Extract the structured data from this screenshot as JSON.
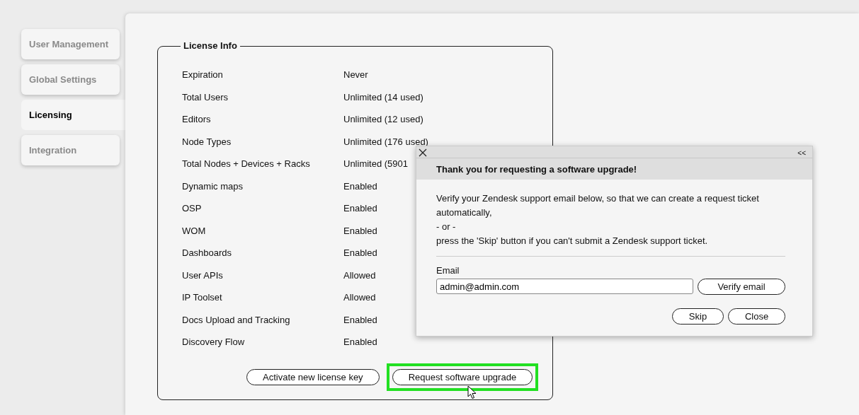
{
  "sidebar": {
    "tabs": [
      {
        "label": "User Management",
        "selected": false
      },
      {
        "label": "Global Settings",
        "selected": false
      },
      {
        "label": "Licensing",
        "selected": true
      },
      {
        "label": "Integration",
        "selected": false
      }
    ]
  },
  "license_info": {
    "title": "License Info",
    "rows": [
      {
        "label": "Expiration",
        "value": "Never"
      },
      {
        "label": "Total Users",
        "value": "Unlimited (14 used)"
      },
      {
        "label": "Editors",
        "value": "Unlimited (12 used)"
      },
      {
        "label": "Node Types",
        "value": "Unlimited (176 used)"
      },
      {
        "label": "Total Nodes + Devices + Racks",
        "value": "Unlimited (5901"
      },
      {
        "label": "Dynamic maps",
        "value": "Enabled"
      },
      {
        "label": "OSP",
        "value": "Enabled"
      },
      {
        "label": "WOM",
        "value": "Enabled"
      },
      {
        "label": "Dashboards",
        "value": "Enabled"
      },
      {
        "label": "User APIs",
        "value": "Allowed"
      },
      {
        "label": "IP Toolset",
        "value": "Allowed"
      },
      {
        "label": "Docs Upload and Tracking",
        "value": "Enabled"
      },
      {
        "label": "Discovery Flow",
        "value": "Enabled"
      }
    ],
    "buttons": [
      {
        "label": "Activate new license key",
        "highlighted": false
      },
      {
        "label": "Request software upgrade",
        "highlighted": true
      }
    ]
  },
  "dialog": {
    "collapse": "<<",
    "title": "Thank you for requesting a software upgrade!",
    "message": [
      "Verify your Zendesk support email below, so that we can create a request ticket automatically,",
      "- or -",
      "press the 'Skip' button if you can't submit a Zendesk support ticket."
    ],
    "email_label": "Email",
    "email_value": "admin@admin.com",
    "verify_button": "Verify email",
    "buttons": [
      "Skip",
      "Close"
    ]
  }
}
